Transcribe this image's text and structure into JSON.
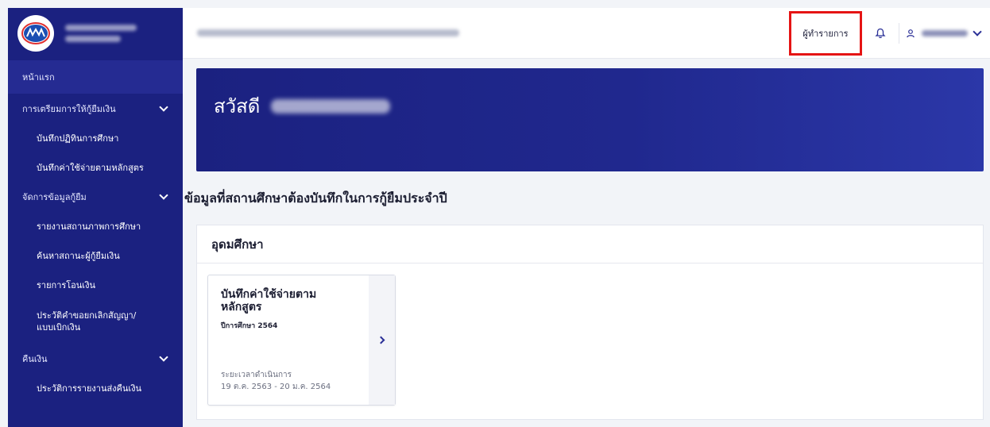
{
  "topbar": {
    "role_label": "ผู้ทำรายการ",
    "bell_icon": "bell-icon",
    "user_icon": "user-icon"
  },
  "sidebar": {
    "items": [
      {
        "label": "หน้าแรก",
        "level": "top"
      },
      {
        "label": "การเตรียมการให้กู้ยืมเงิน",
        "level": "top",
        "expandable": true
      },
      {
        "label": "บันทึกปฏิทินการศึกษา",
        "level": "sub"
      },
      {
        "label": "บันทึกค่าใช้จ่ายตามหลักสูตร",
        "level": "sub"
      },
      {
        "label": "จัดการข้อมูลกู้ยืม",
        "level": "top",
        "expandable": true
      },
      {
        "label": "รายงานสถานภาพการศึกษา",
        "level": "sub"
      },
      {
        "label": "ค้นหาสถานะผู้กู้ยืมเงิน",
        "level": "sub"
      },
      {
        "label": "รายการโอนเงิน",
        "level": "sub"
      },
      {
        "label": "ประวัติคำขอยกเลิกสัญญา/แบบเบิกเงิน",
        "level": "sub"
      },
      {
        "label": "คืนเงิน",
        "level": "top",
        "expandable": true
      },
      {
        "label": "ประวัติการรายงานส่งคืนเงิน",
        "level": "sub"
      }
    ]
  },
  "banner": {
    "greeting": "สวัสดี"
  },
  "main": {
    "section_title": "ข้อมูลที่สถานศึกษาต้องบันทึกในการกู้ยืมประจำปี",
    "panel_title": "อุดมศึกษา",
    "card": {
      "title": "บันทึกค่าใช้จ่ายตาม หลักสูตร",
      "year": "ปีการศึกษา 2564",
      "period_label": "ระยะเวลาดำเนินการ",
      "period": "19 ต.ค. 2563 - 20 ม.ค. 2564"
    }
  },
  "colors": {
    "sidebar": "#1b2180",
    "highlight": "#e51414",
    "accent": "#2b3097"
  }
}
